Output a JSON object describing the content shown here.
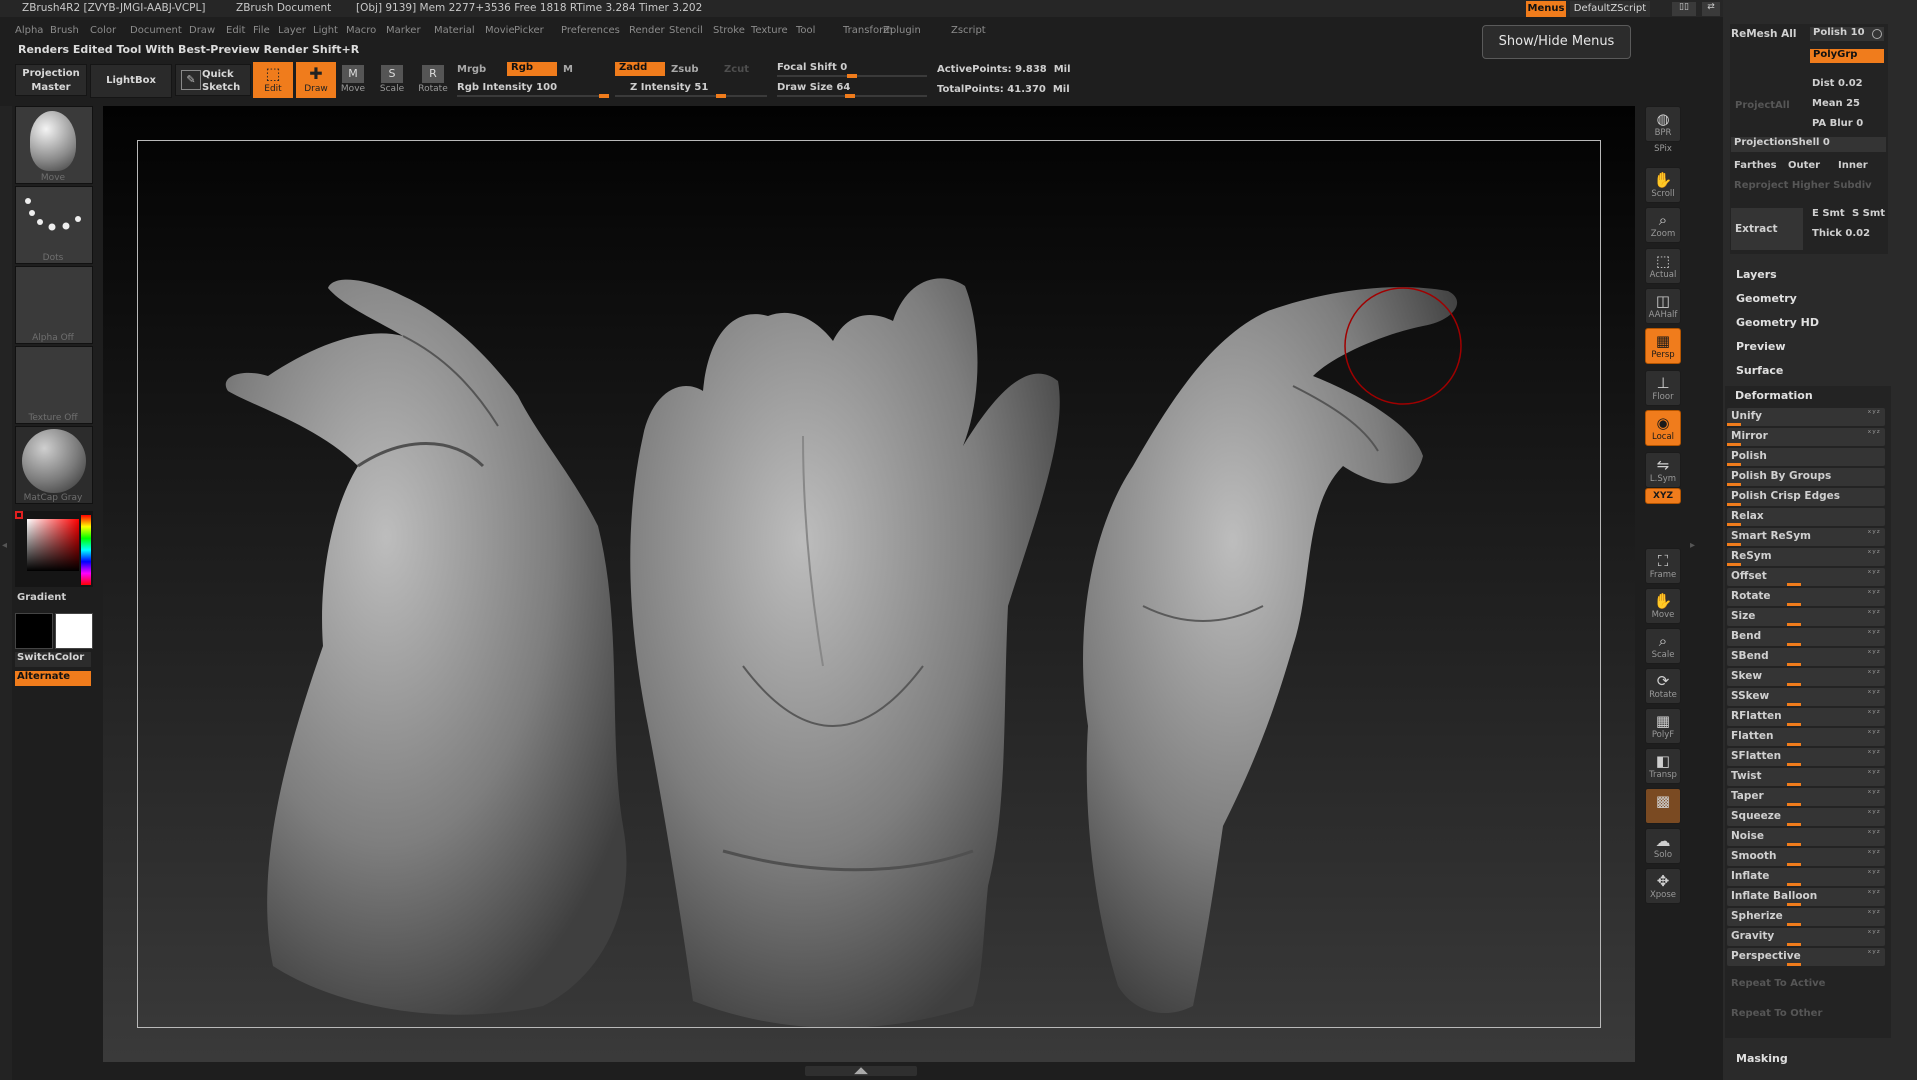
{
  "window": {
    "app": "ZBrush4R2 [ZVYB-JMGI-AABJ-VCPL]",
    "document": "ZBrush Document",
    "stats": "[Obj] 9139] Mem 2277+3536 Free 1818 RTime 3.284 Timer 3.202",
    "menus_button": "Menus",
    "script": "DefaultZScript"
  },
  "menubar": [
    "Alpha",
    "Brush",
    "Color",
    "Document",
    "Draw",
    "Edit",
    "File",
    "Layer",
    "Light",
    "Macro",
    "Marker",
    "Material",
    "Movie",
    "Picker",
    "Preferences",
    "Render",
    "Stencil",
    "Stroke",
    "Texture",
    "Tool",
    "Transform",
    "Zplugin",
    "Zscript"
  ],
  "notice": "Renders Edited Tool With Best-Preview Render   Shift+R",
  "tooltip": "Show/Hide Menus",
  "toolbar": {
    "projection_master": "Projection Master",
    "lightbox": "LightBox",
    "quick_sketch": "Quick Sketch",
    "edit": "Edit",
    "draw": "Draw",
    "move": "Move",
    "scale": "Scale",
    "rotate": "Rotate",
    "mrgb": "Mrgb",
    "rgb": "Rgb",
    "m": "M",
    "rgb_intensity": "Rgb Intensity 100",
    "zadd": "Zadd",
    "zsub": "Zsub",
    "zcut": "Zcut",
    "z_intensity": "Z Intensity 51",
    "focal_shift": "Focal Shift 0",
    "draw_size": "Draw Size 64",
    "active_points": "ActivePoints: 9.838  Mil",
    "total_points": "TotalPoints: 41.370  Mil"
  },
  "left_shelf": {
    "brush": "Move",
    "stroke": "Dots",
    "alpha": "Alpha  Off",
    "texture": "Texture  Off",
    "material": "MatCap  Gray",
    "gradient": "Gradient",
    "switch_color": "SwitchColor",
    "alternate": "Alternate"
  },
  "right_shelf": [
    {
      "label": "BPR",
      "icon": "bpr-icon"
    },
    {
      "label": "SPix",
      "icon": ""
    },
    {
      "label": "Scroll",
      "icon": "scroll-icon"
    },
    {
      "label": "Zoom",
      "icon": "zoom-icon"
    },
    {
      "label": "Actual",
      "icon": "actual-icon"
    },
    {
      "label": "AAHalf",
      "icon": "aahalf-icon"
    },
    {
      "label": "Persp",
      "icon": "persp-icon",
      "on": true
    },
    {
      "label": "Floor",
      "icon": "floor-icon"
    },
    {
      "label": "Local",
      "icon": "local-icon",
      "on": true
    },
    {
      "label": "L.Sym",
      "icon": "lsym-icon"
    },
    {
      "label": "XYZ",
      "icon": "xyz-icon",
      "on": true
    },
    {
      "label": "Frame",
      "icon": "frame-icon"
    },
    {
      "label": "Move",
      "icon": "move-icon"
    },
    {
      "label": "Scale",
      "icon": "scale-icon"
    },
    {
      "label": "Rotate",
      "icon": "rotate-icon"
    },
    {
      "label": "PolyF",
      "icon": "polyf-icon"
    },
    {
      "label": "Transp",
      "icon": "transp-icon"
    },
    {
      "label": "Ghost",
      "icon": "ghost-icon"
    },
    {
      "label": "Solo",
      "icon": "solo-icon"
    },
    {
      "label": "Xpose",
      "icon": "xpose-icon"
    }
  ],
  "tray": {
    "remesh_all": "ReMesh All",
    "polish": "Polish 10",
    "polygrp": "PolyGrp",
    "project_all": "ProjectAll",
    "dist": "Dist 0.02",
    "mean": "Mean 25",
    "pa_blur": "PA Blur 0",
    "projection_shell": "ProjectionShell 0",
    "farthest": "Farthes",
    "outer": "Outer",
    "inner": "Inner",
    "reproject": "Reproject Higher Subdiv",
    "extract": "Extract",
    "e_smt": "E Smt",
    "s_smt": "S Smt",
    "thick": "Thick 0.02",
    "sections": [
      "Layers",
      "Geometry",
      "Geometry HD",
      "Preview",
      "Surface"
    ],
    "deformation_title": "Deformation",
    "deformation": [
      {
        "label": "Unify"
      },
      {
        "label": "Mirror"
      },
      {
        "label": "Polish"
      },
      {
        "label": "Polish By Groups"
      },
      {
        "label": "Polish Crisp Edges"
      },
      {
        "label": "Relax"
      },
      {
        "label": "Smart ReSym"
      },
      {
        "label": "ReSym"
      },
      {
        "label": "Offset"
      },
      {
        "label": "Rotate"
      },
      {
        "label": "Size"
      },
      {
        "label": "Bend"
      },
      {
        "label": "SBend"
      },
      {
        "label": "Skew"
      },
      {
        "label": "SSkew"
      },
      {
        "label": "RFlatten"
      },
      {
        "label": "Flatten"
      },
      {
        "label": "SFlatten"
      },
      {
        "label": "Twist"
      },
      {
        "label": "Taper"
      },
      {
        "label": "Squeeze"
      },
      {
        "label": "Noise"
      },
      {
        "label": "Smooth"
      },
      {
        "label": "Inflate"
      },
      {
        "label": "Inflate Balloon"
      },
      {
        "label": "Spherize"
      },
      {
        "label": "Gravity"
      },
      {
        "label": "Perspective"
      }
    ],
    "repeat_active": "Repeat To Active",
    "repeat_other": "Repeat To Other",
    "masking": "Masking"
  },
  "colors": {
    "accent": "#f07c1c",
    "background": "#1e1e1e",
    "panel": "#2a2a2a"
  }
}
